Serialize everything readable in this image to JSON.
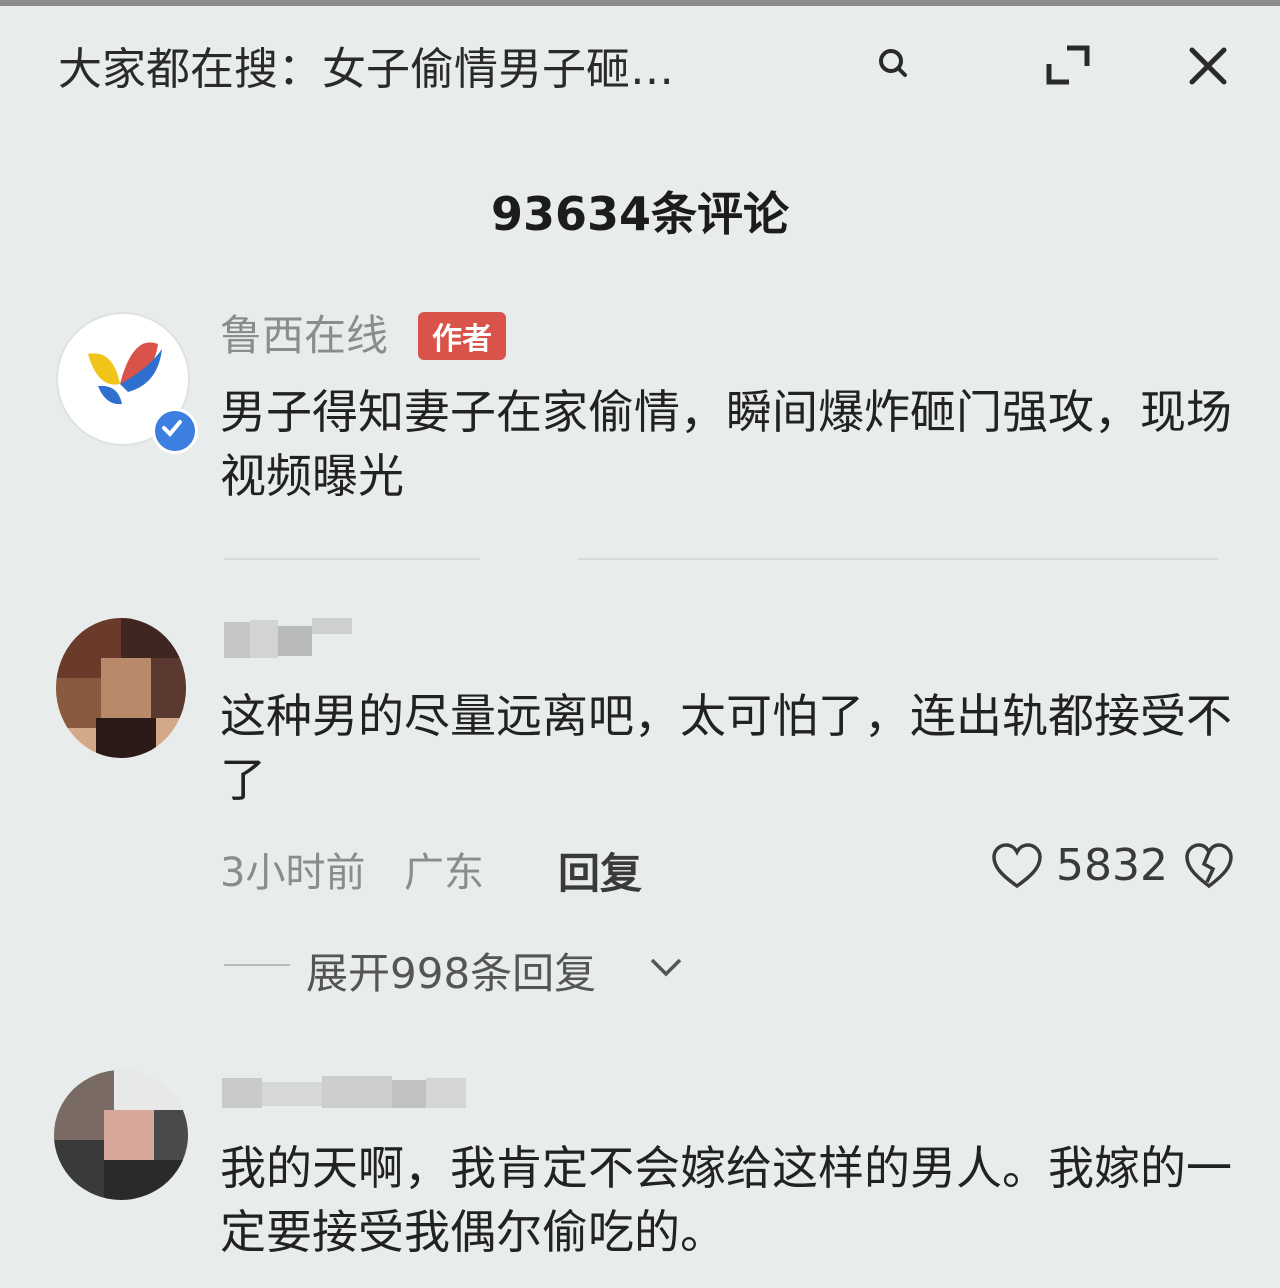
{
  "header": {
    "search_text": "大家都在搜：女子偷情男子砸…",
    "icons": [
      "search-icon",
      "expand-icon",
      "close-icon"
    ]
  },
  "comments_header": {
    "count_label": "93634条评论"
  },
  "author_post": {
    "name": "鲁西在线",
    "badge": "作者",
    "text": "男子得知妻子在家偷情，瞬间爆炸砸门强攻，现场视频曝光",
    "avatar_label": "鲁西在线"
  },
  "comments": [
    {
      "text": "这种男的尽量远离吧，太可怕了，连出轨都接受不了",
      "time": "3小时前",
      "location": "广东",
      "reply_label": "回复",
      "likes": "5832",
      "expand_label": "展开998条回复"
    },
    {
      "text": "我的天啊，我肯定不会嫁给这样的男人。我嫁的一定要接受我偶尔偷吃的。"
    }
  ],
  "colors": {
    "background": "#e9ecec",
    "author_badge": "#d9534a",
    "verified": "#3d7fe0",
    "muted_text": "#8a8d8e"
  }
}
